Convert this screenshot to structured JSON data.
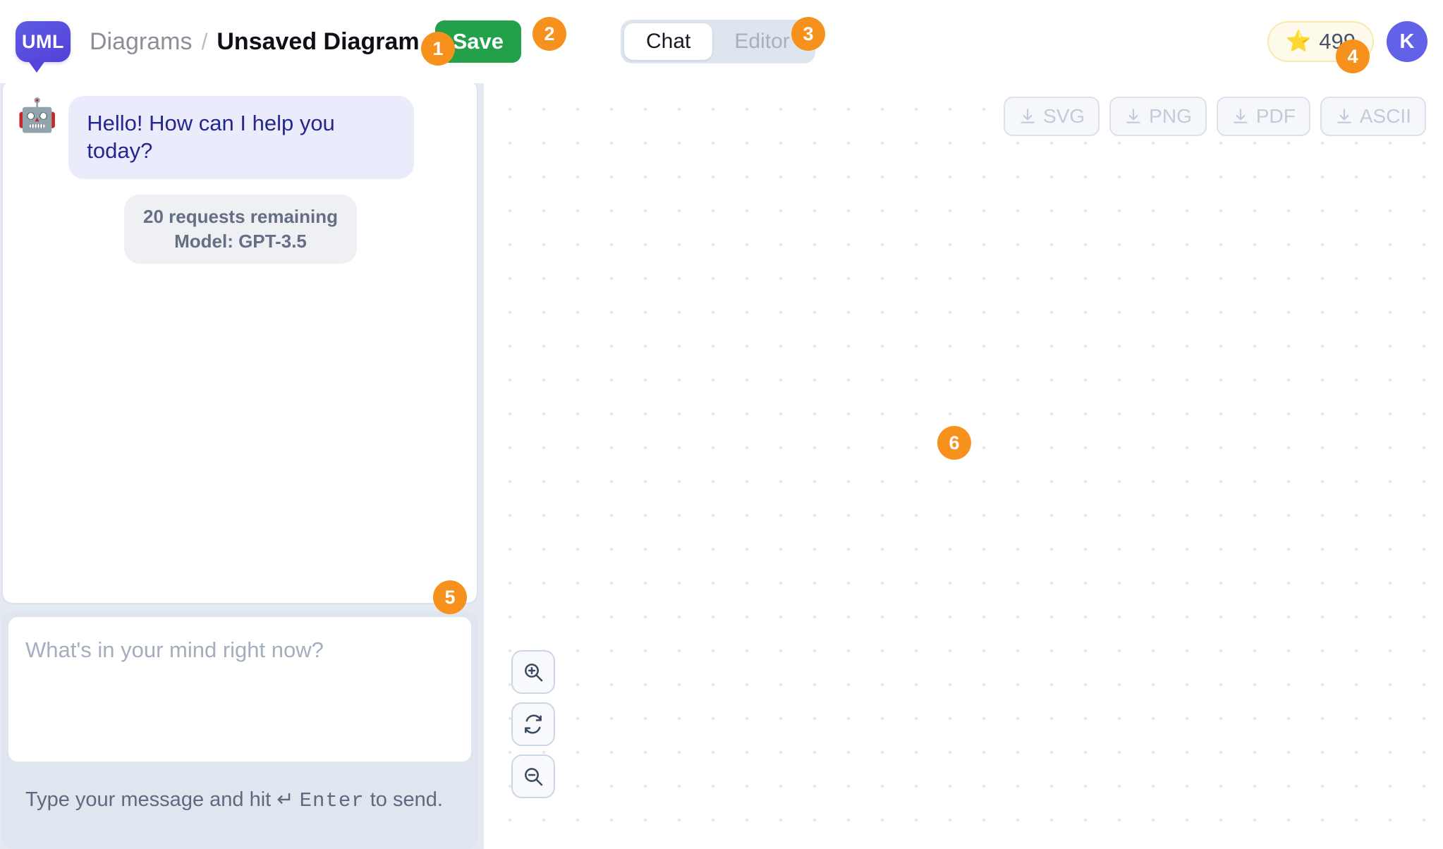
{
  "header": {
    "logo_text": "UML",
    "breadcrumb_root": "Diagrams",
    "breadcrumb_separator": "/",
    "breadcrumb_current": "Unsaved Diagram",
    "save_label": "Save",
    "tabs": [
      {
        "label": "Chat",
        "active": true
      },
      {
        "label": "Editor",
        "active": false
      }
    ],
    "credits": {
      "icon": "star-icon",
      "value": "499"
    },
    "avatar_initial": "K"
  },
  "chat": {
    "bot_avatar_icon": "robot-icon",
    "messages": [
      {
        "role": "assistant",
        "text": "Hello! How can I help you today?"
      }
    ],
    "status": {
      "requests_line": "20 requests remaining",
      "model_line": "Model: GPT-3.5"
    },
    "input": {
      "value": "",
      "placeholder": "What's in your mind right now?"
    },
    "hint_prefix": "Type your message and hit",
    "hint_key_symbol": "↵",
    "hint_key": "Enter",
    "hint_suffix": "to send."
  },
  "canvas": {
    "export_buttons": [
      {
        "label": "SVG",
        "icon": "download-icon",
        "enabled": false
      },
      {
        "label": "PNG",
        "icon": "download-icon",
        "enabled": false
      },
      {
        "label": "PDF",
        "icon": "download-icon",
        "enabled": false
      },
      {
        "label": "ASCII",
        "icon": "download-icon",
        "enabled": false
      }
    ],
    "zoom_controls": [
      {
        "icon": "zoom-in-icon",
        "name": "zoom-in"
      },
      {
        "icon": "refresh-icon",
        "name": "reset-view"
      },
      {
        "icon": "zoom-out-icon",
        "name": "zoom-out"
      }
    ]
  },
  "annotations": [
    {
      "number": "1",
      "target": "breadcrumb-current"
    },
    {
      "number": "2",
      "target": "save-button"
    },
    {
      "number": "3",
      "target": "editor-tab"
    },
    {
      "number": "4",
      "target": "credits-pill"
    },
    {
      "number": "5",
      "target": "chat-messages-area"
    },
    {
      "number": "6",
      "target": "diagram-canvas"
    }
  ],
  "colors": {
    "brand_purple": "#5b5ce0",
    "save_green": "#22a04a",
    "annotation_orange": "#f7911e",
    "bubble_bg": "#eaecfb",
    "bubble_text": "#26268f",
    "panel_bg": "#e4e9f2"
  }
}
